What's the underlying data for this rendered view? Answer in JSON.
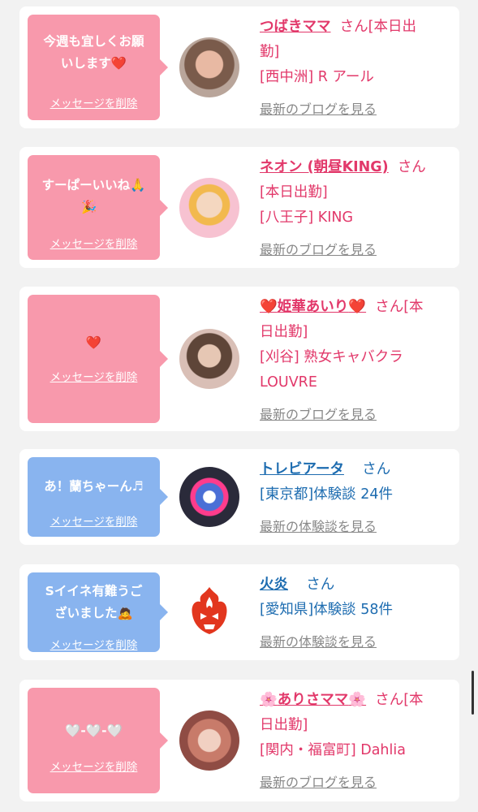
{
  "cards": [
    {
      "bubble_text_1": "今週も宜しくお願",
      "bubble_text_2": "いします",
      "bubble_emoji": "❤️",
      "delete_label": "メッセージを削除",
      "name": "つばきママ",
      "suffix": "さん[本日出",
      "line2": "勤]",
      "line3": "[西中洲] R アール",
      "link": "最新のブログを見る"
    },
    {
      "bubble_text_1": "すーぱーいいね🙏",
      "bubble_text_2": "🎉",
      "delete_label": "メッセージを削除",
      "name": "ネオン (朝昼KING)",
      "suffix": "さん",
      "line2": "[本日出勤]",
      "line3": "[八王子] KING",
      "link": "最新のブログを見る"
    },
    {
      "bubble_text_1": "❤️",
      "delete_label": "メッセージを削除",
      "name": "姫華あいり",
      "name_prefix": "❤️",
      "name_suffix": "❤️",
      "suffix": "さん[本",
      "line2": "日出勤]",
      "line3": "[刈谷] 熟女キャバクラ",
      "line4": "LOUVRE",
      "link": "最新のブログを見る"
    },
    {
      "bubble_text_1": "あ！蘭ちゃーん♬",
      "delete_label": "メッセージを削除",
      "name": "トレビアータ",
      "suffix": "さん",
      "line2": "[東京都]体験談 24件",
      "link": "最新の体験談を見る"
    },
    {
      "bubble_text_1": "Sイイネ有難うご",
      "bubble_text_2": "ざいました🙇",
      "delete_label": "メッセージを削除",
      "name": "火炎",
      "suffix": "さん",
      "line2": "[愛知県]体験談 58件",
      "link": "最新の体験談を見る"
    },
    {
      "bubble_text_1": "🤍-🤍-🤍",
      "delete_label": "メッセージを削除",
      "name": "ありさママ",
      "name_prefix": "🌸",
      "name_suffix": "🌸",
      "suffix": "さん[本",
      "line2": "日出勤]",
      "line3": "[関内・福富町] Dahlia",
      "link": "最新のブログを見る"
    }
  ],
  "colors": {
    "pink_bubble": "#f899ac",
    "blue_bubble": "#89b4ef",
    "pink_name": "#e2386a",
    "blue_name": "#1d6cb0"
  }
}
